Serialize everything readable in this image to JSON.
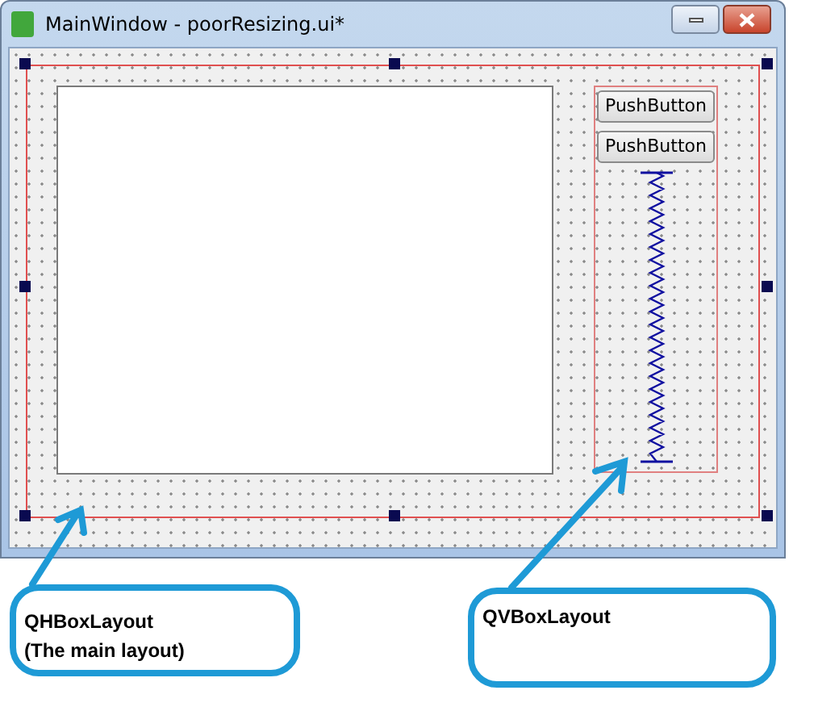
{
  "window": {
    "title": "MainWindow - poorResizing.ui*"
  },
  "form": {
    "buttons": [
      "PushButton",
      "PushButton"
    ]
  },
  "annotations": [
    {
      "lines": [
        "QHBoxLayout",
        "(The main layout)"
      ]
    },
    {
      "lines": [
        "QVBoxLayout"
      ]
    }
  ]
}
